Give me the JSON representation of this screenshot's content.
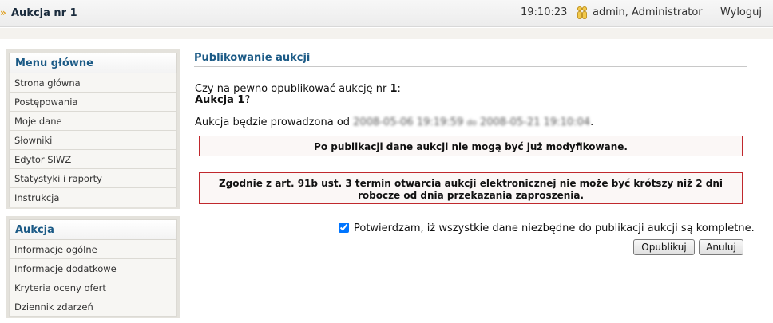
{
  "header": {
    "title": "Aukcja nr 1",
    "time": "19:10:23",
    "user": "admin, Administrator",
    "logout": "Wyloguj"
  },
  "sidebar": {
    "main_title": "Menu główne",
    "main_items": [
      "Strona główna",
      "Postępowania",
      "Moje dane",
      "Słowniki",
      "Edytor SIWZ",
      "Statystyki i raporty",
      "Instrukcja"
    ],
    "auction_title": "Aukcja",
    "auction_items": [
      "Informacje ogólne",
      "Informacje dodatkowe",
      "Kryteria oceny ofert",
      "Dziennik zdarzeń"
    ]
  },
  "main": {
    "title": "Publikowanie aukcji",
    "question_prefix": "Czy na pewno opublikować aukcję nr ",
    "auction_number": "1",
    "question_colon": ":",
    "auction_name": "Aukcja 1",
    "question_mark": "?",
    "dates_prefix": "Aukcja będzie prowadzona od ",
    "date_from": "2008-05-06 19:19:59",
    "date_sep": "do",
    "date_to": "2008-05-21 19:10:04",
    "date_end": ".",
    "alert1": "Po publikacji dane aukcji nie mogą być już modyfikowane.",
    "alert2_line1": "Zgodnie z art. 91b ust. 3 termin otwarcia aukcji elektronicznej nie może być krótszy niż 2 dni",
    "alert2_line2": "robocze od dnia przekazania zaproszenia.",
    "confirm_label": "Potwierdzam, iż wszystkie dane niezbędne do publikacji aukcji są kompletne.",
    "publish_button": "Opublikuj",
    "cancel_button": "Anuluj"
  },
  "colors": {
    "accent": "#1b5a86",
    "alert_border": "#c0282d"
  }
}
